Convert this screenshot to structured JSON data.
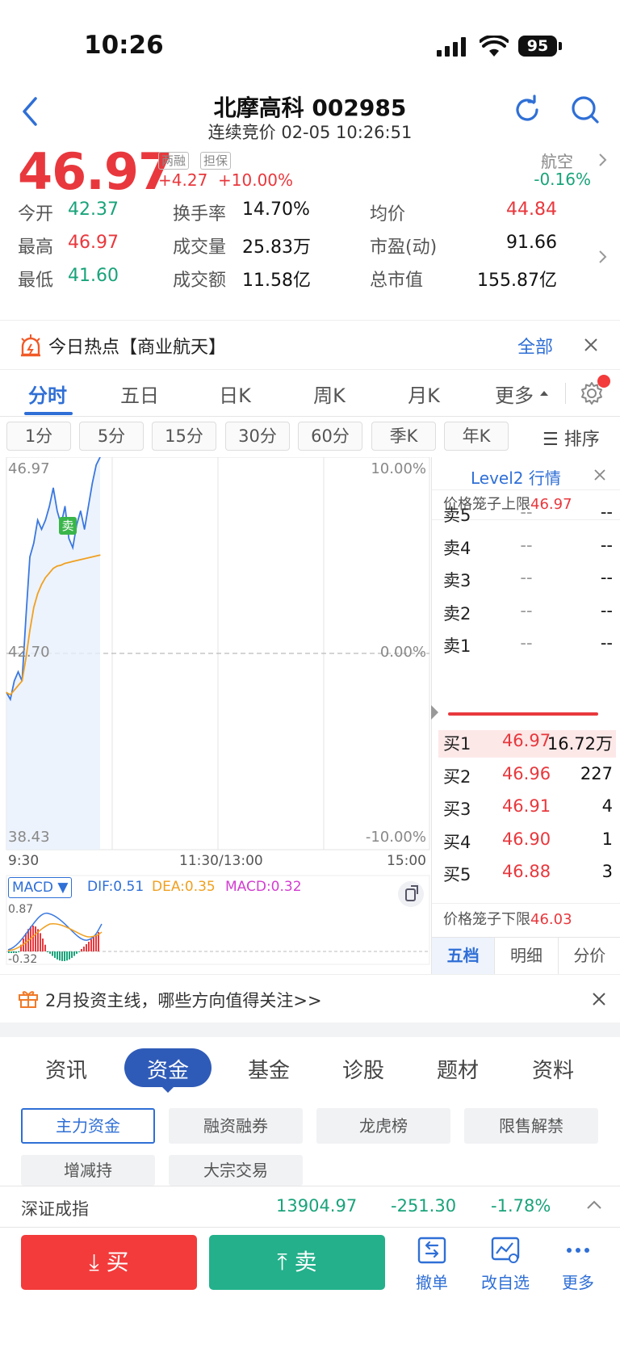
{
  "status_bar": {
    "time": "10:26",
    "battery": "95"
  },
  "header": {
    "title": "北摩高科 002985",
    "subtitle": "连续竞价 02-05 10:26:51"
  },
  "quote": {
    "price": "46.97",
    "tags": [
      "两融",
      "担保"
    ],
    "change": "+4.27",
    "change_pct": "+10.00%",
    "sector_name": "航空",
    "sector_pct": "-0.16%",
    "colors": {
      "up": "#e8383d",
      "down": "#19a37a",
      "accent": "#2f6fd6"
    }
  },
  "stats": [
    {
      "k": "今开",
      "v": "42.37",
      "color": "green"
    },
    {
      "k": "换手率",
      "v": "14.70%",
      "color": "black"
    },
    {
      "k": "均价",
      "v": "44.84",
      "color": "red"
    },
    {
      "k": "最高",
      "v": "46.97",
      "color": "red"
    },
    {
      "k": "成交量",
      "v": "25.83万",
      "color": "black"
    },
    {
      "k": "市盈(动)",
      "v": "91.66",
      "color": "black"
    },
    {
      "k": "最低",
      "v": "41.60",
      "color": "green"
    },
    {
      "k": "成交额",
      "v": "11.58亿",
      "color": "black"
    },
    {
      "k": "总市值",
      "v": "155.87亿",
      "color": "black"
    }
  ],
  "hot": {
    "text": "今日热点【商业航天】",
    "all": "全部"
  },
  "tabs": [
    "分时",
    "五日",
    "日K",
    "周K",
    "月K",
    "更多"
  ],
  "ktabs": [
    "1分",
    "5分",
    "15分",
    "30分",
    "60分",
    "季K",
    "年K"
  ],
  "sort_label": "排序",
  "chart": {
    "y_top": "46.97",
    "y_mid": "42.70",
    "y_bot": "38.43",
    "pct_top": "10.00%",
    "pct_mid": "0.00%",
    "pct_bot": "-10.00%",
    "t_start": "9:30",
    "t_mid": "11:30/13:00",
    "t_end": "15:00",
    "marker": "卖",
    "macd_label": "MACD",
    "dif": "DIF:0.51",
    "dea": "DEA:0.35",
    "macd": "MACD:0.32",
    "macd_top": "0.87",
    "macd_bot": "-0.32"
  },
  "chart_data": {
    "type": "line",
    "title": "",
    "xlabel": "",
    "ylabel": "",
    "ylim": [
      38.43,
      46.97
    ],
    "series": [
      {
        "values": [
          41.85,
          41.7,
          42.1,
          42.3,
          42.1,
          43.5,
          44.8,
          45.1,
          45.6,
          45.4,
          45.6,
          45.9,
          46.3,
          45.8,
          45.5,
          45.9,
          45.2,
          45.0,
          45.5,
          45.8,
          45.4,
          45.9,
          46.4,
          46.8,
          46.97
        ]
      },
      {
        "values": [
          41.85,
          41.8,
          41.9,
          42.0,
          42.1,
          42.6,
          43.2,
          43.7,
          44.0,
          44.2,
          44.35,
          44.45,
          44.55,
          44.6,
          44.62,
          44.66,
          44.68,
          44.7,
          44.72,
          44.74,
          44.76,
          44.78,
          44.8,
          44.82,
          44.84
        ]
      }
    ]
  },
  "orderbook": {
    "title": "Level2 行情",
    "upper_label": "价格笼子上限",
    "upper": "46.97",
    "lower_label": "价格笼子下限",
    "lower": "46.03",
    "asks": [
      {
        "l": "卖5",
        "p": "--",
        "v": "--"
      },
      {
        "l": "卖4",
        "p": "--",
        "v": "--"
      },
      {
        "l": "卖3",
        "p": "--",
        "v": "--"
      },
      {
        "l": "卖2",
        "p": "--",
        "v": "--"
      },
      {
        "l": "卖1",
        "p": "--",
        "v": "--"
      }
    ],
    "bids": [
      {
        "l": "买1",
        "p": "46.97",
        "v": "16.72万"
      },
      {
        "l": "买2",
        "p": "46.96",
        "v": "227"
      },
      {
        "l": "买3",
        "p": "46.91",
        "v": "4"
      },
      {
        "l": "买4",
        "p": "46.90",
        "v": "1"
      },
      {
        "l": "买5",
        "p": "46.88",
        "v": "3"
      }
    ],
    "tabs": [
      "五档",
      "明细",
      "分价"
    ]
  },
  "promo": {
    "text": "2月投资主线，哪些方向值得关注>>"
  },
  "bottom_tabs": [
    "资讯",
    "资金",
    "基金",
    "诊股",
    "题材",
    "资料"
  ],
  "sub_tabs": [
    "主力资金",
    "融资融券",
    "龙虎榜",
    "限售解禁",
    "增减持",
    "大宗交易"
  ],
  "index": {
    "name": "深证成指",
    "value": "13904.97",
    "change": "-251.30",
    "pct": "-1.78%"
  },
  "actions": {
    "buy": "买",
    "sell": "卖",
    "cancel": "撤单",
    "edit_watch": "改自选",
    "more": "更多"
  }
}
